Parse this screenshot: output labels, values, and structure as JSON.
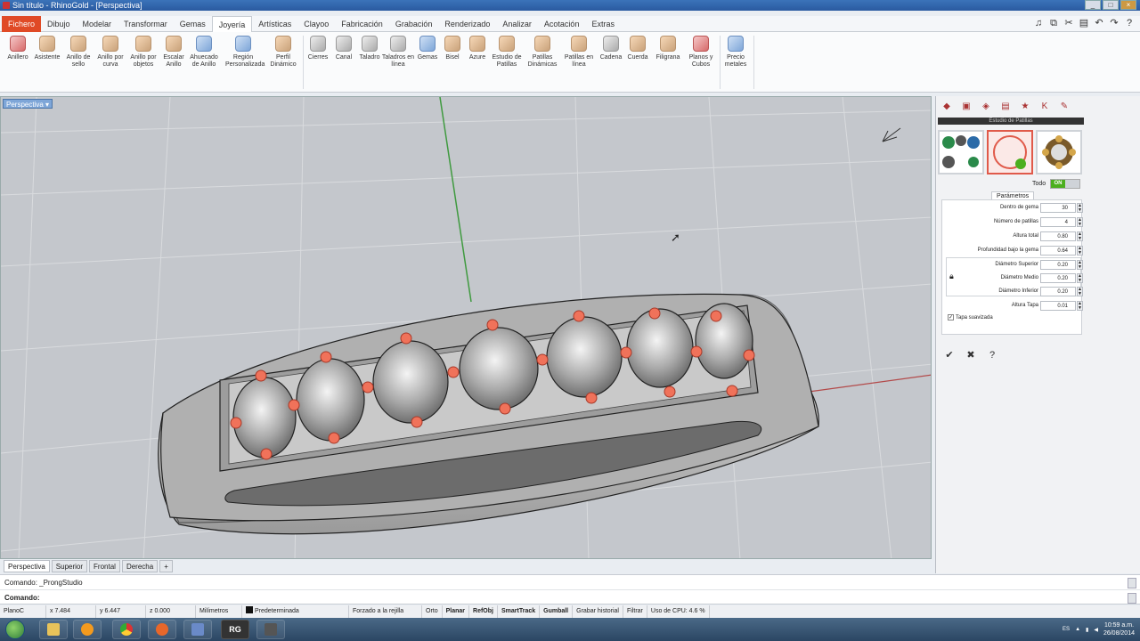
{
  "window": {
    "title": "Sin título - RhinoGold - [Perspectiva]",
    "controls": [
      "_",
      "□",
      "×"
    ]
  },
  "ribbon_tabs": [
    "Fichero",
    "Dibujo",
    "Modelar",
    "Transformar",
    "Gemas",
    "Joyería",
    "Artísticas",
    "Clayoo",
    "Fabricación",
    "Grabación",
    "Renderizado",
    "Analizar",
    "Acotación",
    "Extras"
  ],
  "active_tab": "Joyería",
  "quick_access_icons": [
    "mic-icon",
    "copy-icon",
    "cut-icon",
    "paste-icon",
    "undo-icon",
    "redo-icon",
    "help-icon"
  ],
  "ribbon_groups": [
    {
      "items": [
        "Anillero",
        "Asistente",
        "Anillo de sello",
        "Anillo por curva",
        "Anillo por objetos",
        "Escalar Anillo",
        "Ahuecado de Anillo",
        "Región Personalizada",
        "Perfil Dinámico"
      ]
    },
    {
      "items": [
        "Cierres",
        "Canal",
        "Taladro",
        "Taladros en línea",
        "Gemas",
        "Bisel",
        "Azure",
        "Estudio de Patillas",
        "Patillas Dinámicas",
        "Patillas en línea",
        "Cadena",
        "Cuerda",
        "Filigrana",
        "Planos y Cubos"
      ]
    },
    {
      "items": [
        "Precio metales"
      ]
    }
  ],
  "viewport": {
    "label": "Perspectiva"
  },
  "view_tabs": [
    "Perspectiva",
    "Superior",
    "Frontal",
    "Derecha",
    "+"
  ],
  "command": {
    "history": "Comando: _ProngStudio",
    "prompt": "Comando:"
  },
  "status_bar": {
    "cplane": "PlanoC",
    "x": "x 7.484",
    "y": "y 6.447",
    "z": "z 0.000",
    "units": "Milímetros",
    "layer": "Predeterminada",
    "grid_snap": "Forzado a la rejilla",
    "orto": "Orto",
    "planar": "Planar",
    "refobj": "RefObj",
    "smarttrack": "SmartTrack",
    "gumball": "Gumball",
    "history": "Grabar historial",
    "filter": "Filtrar",
    "cpu": "Uso de CPU: 4.6 %"
  },
  "taskbar": {
    "apps": [
      "start-icon",
      "explorer-icon",
      "media-icon",
      "chrome-icon",
      "firefox-icon",
      "save-icon",
      "RG",
      "photo-icon"
    ],
    "tray": {
      "lang": "ES",
      "time": "10:59 a.m.",
      "date": "26/08/2014"
    }
  },
  "panel": {
    "tabs": [
      "color-icon",
      "display-icon",
      "tools-icon",
      "layers-icon",
      "star-icon",
      "K",
      "brush-icon"
    ],
    "title": "Estudio de Patillas",
    "todo_label": "Todo",
    "todo_state": "ON",
    "params_tab": "Parámetros",
    "params": [
      {
        "label": "Dentro de gema",
        "value": "30"
      },
      {
        "label": "Número de patillas",
        "value": "4"
      },
      {
        "label": "Altura total",
        "value": "0.80"
      },
      {
        "label": "Profundidad bajo la gema",
        "value": "0.64"
      },
      {
        "label": "Diámetro Superior",
        "value": "0.20"
      },
      {
        "label": "Diámetro Medio",
        "value": "0.20"
      },
      {
        "label": "Diámetro Inferior",
        "value": "0.20"
      },
      {
        "label": "Altura Tapa",
        "value": "0.01"
      }
    ],
    "tapa_label": "Tapa suavizada",
    "actions": [
      "✔",
      "✖",
      "?"
    ]
  },
  "colors": {
    "accent": "#e04a26",
    "viewport_bg": "#c4c7cc",
    "prong": "#f0725a",
    "active_green": "#4caf1f",
    "taskbar": "#2b4663"
  }
}
